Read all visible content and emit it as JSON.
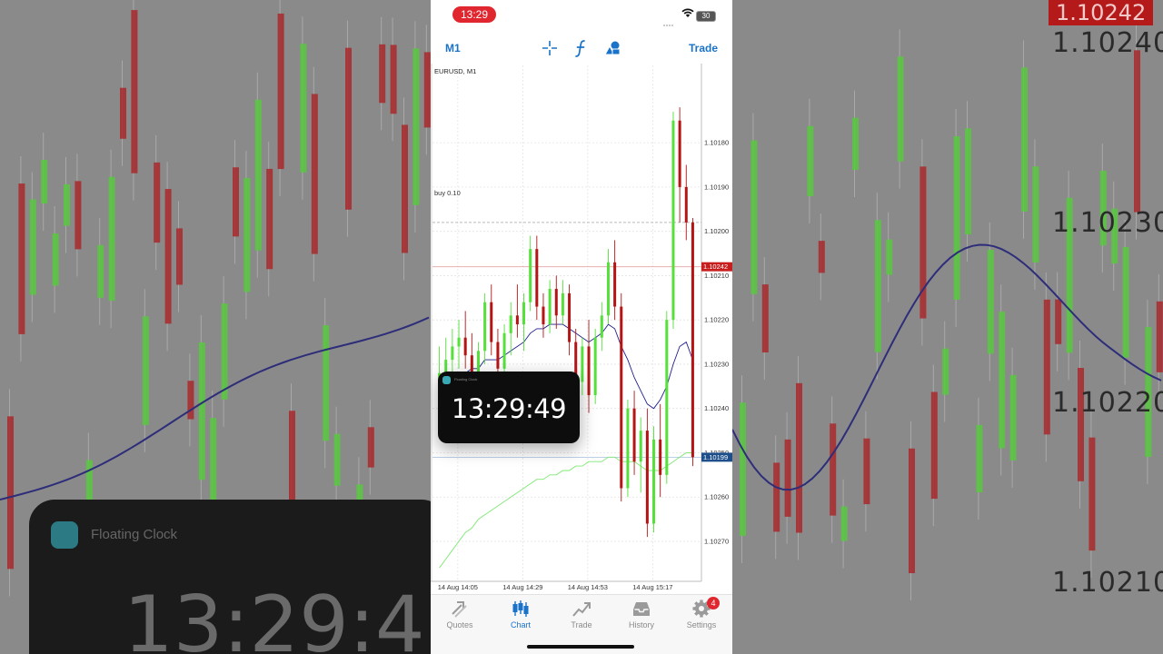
{
  "status_bar": {
    "time": "13:29",
    "battery": "30"
  },
  "toolbar": {
    "timeframe": "M1",
    "trade": "Trade"
  },
  "chart": {
    "symbol_label": "EURUSD, M1",
    "order_line_label": "buy 0.10",
    "ask_price": "1.10242",
    "bid_price": "1.10199",
    "price_ticks": [
      "1.10270",
      "1.10260",
      "1.10250",
      "1.10240",
      "1.10230",
      "1.10220",
      "1.10210",
      "1.10200",
      "1.10190",
      "1.10180"
    ],
    "time_ticks": [
      "14 Aug 14:05",
      "14 Aug 14:29",
      "14 Aug 14:53",
      "14 Aug 15:17"
    ]
  },
  "chart_data": {
    "type": "candlestick",
    "symbol": "EURUSD",
    "timeframe": "M1",
    "ylim": [
      1.10172,
      1.10285
    ],
    "y_ticks": [
      1.1018,
      1.1019,
      1.102,
      1.1021,
      1.1022,
      1.1023,
      1.1024,
      1.1025,
      1.1026,
      1.1027
    ],
    "x_ticks": [
      "14 Aug 14:05",
      "14 Aug 14:29",
      "14 Aug 14:53",
      "14 Aug 15:17"
    ],
    "ask": 1.10242,
    "bid": 1.10199,
    "order_level": 1.10252,
    "candles": [
      [
        1.10214,
        1.10224,
        1.10209,
        1.10218
      ],
      [
        1.10218,
        1.10226,
        1.10213,
        1.10221
      ],
      [
        1.10221,
        1.10228,
        1.10216,
        1.10224
      ],
      [
        1.10224,
        1.1023,
        1.10219,
        1.10226
      ],
      [
        1.10226,
        1.10232,
        1.10219,
        1.10222
      ],
      [
        1.10222,
        1.10227,
        1.10214,
        1.10217
      ],
      [
        1.10217,
        1.10225,
        1.10213,
        1.10223
      ],
      [
        1.10223,
        1.10236,
        1.1022,
        1.10234
      ],
      [
        1.10234,
        1.10238,
        1.10222,
        1.10225
      ],
      [
        1.10225,
        1.10228,
        1.10216,
        1.10219
      ],
      [
        1.10219,
        1.10229,
        1.10216,
        1.10227
      ],
      [
        1.10227,
        1.10234,
        1.10222,
        1.10231
      ],
      [
        1.10231,
        1.10238,
        1.10226,
        1.10229
      ],
      [
        1.10229,
        1.10236,
        1.10223,
        1.10234
      ],
      [
        1.10234,
        1.10249,
        1.10232,
        1.10246
      ],
      [
        1.10246,
        1.10249,
        1.1023,
        1.10233
      ],
      [
        1.10233,
        1.10236,
        1.10226,
        1.10229
      ],
      [
        1.10229,
        1.10239,
        1.10227,
        1.10237
      ],
      [
        1.10237,
        1.1024,
        1.10228,
        1.10231
      ],
      [
        1.10231,
        1.10239,
        1.10229,
        1.10236
      ],
      [
        1.10236,
        1.10238,
        1.10222,
        1.10225
      ],
      [
        1.10225,
        1.10228,
        1.10212,
        1.10216
      ],
      [
        1.10216,
        1.10226,
        1.10213,
        1.10224
      ],
      [
        1.10224,
        1.1023,
        1.10209,
        1.10213
      ],
      [
        1.10213,
        1.10228,
        1.10211,
        1.10226
      ],
      [
        1.10226,
        1.10234,
        1.10223,
        1.10231
      ],
      [
        1.10231,
        1.10246,
        1.10229,
        1.10243
      ],
      [
        1.10243,
        1.10248,
        1.1023,
        1.10233
      ],
      [
        1.10233,
        1.10236,
        1.10189,
        1.10192
      ],
      [
        1.10192,
        1.10212,
        1.1019,
        1.1021
      ],
      [
        1.1021,
        1.10214,
        1.10195,
        1.10198
      ],
      [
        1.10198,
        1.10208,
        1.10191,
        1.10205
      ],
      [
        1.10205,
        1.1021,
        1.10181,
        1.10184
      ],
      [
        1.10184,
        1.10206,
        1.10182,
        1.10203
      ],
      [
        1.10203,
        1.10211,
        1.1019,
        1.10195
      ],
      [
        1.10195,
        1.10232,
        1.10193,
        1.1023
      ],
      [
        1.1023,
        1.10277,
        1.10228,
        1.10275
      ],
      [
        1.10275,
        1.10278,
        1.10252,
        1.1026
      ],
      [
        1.1026,
        1.10265,
        1.10248,
        1.10252
      ],
      [
        1.10252,
        1.10253,
        1.10197,
        1.10199
      ]
    ],
    "series": [
      {
        "values": [
          1.10215,
          1.10215,
          1.10216,
          1.10217,
          1.10218,
          1.10219,
          1.10219,
          1.10221,
          1.10221,
          1.10221,
          1.10222,
          1.10223,
          1.10224,
          1.10225,
          1.10227,
          1.10228,
          1.10228,
          1.10229,
          1.10229,
          1.10229,
          1.10228,
          1.10227,
          1.10226,
          1.10225,
          1.10226,
          1.10227,
          1.10229,
          1.10228,
          1.10224,
          1.10221,
          1.10217,
          1.10214,
          1.10211,
          1.1021,
          1.10212,
          1.10215,
          1.1022,
          1.10224,
          1.10225,
          1.10221
        ]
      },
      {
        "values": [
          1.10174,
          1.10176,
          1.10178,
          1.1018,
          1.10182,
          1.10183,
          1.10185,
          1.10186,
          1.10187,
          1.10188,
          1.10189,
          1.1019,
          1.10191,
          1.10192,
          1.10193,
          1.10194,
          1.10194,
          1.10195,
          1.10195,
          1.10196,
          1.10196,
          1.10197,
          1.10197,
          1.10198,
          1.10198,
          1.10198,
          1.10199,
          1.10199,
          1.10198,
          1.10198,
          1.10198,
          1.10197,
          1.10196,
          1.10196,
          1.10196,
          1.10197,
          1.10198,
          1.10199,
          1.102,
          1.102
        ]
      }
    ]
  },
  "floating_clock": {
    "title": "Floating Clock",
    "time": "13:29:49"
  },
  "background": {
    "prices": [
      "1.10240",
      "1.10230",
      "1.10220",
      "1.10210"
    ],
    "price_tag": "1.10242",
    "clock_title": "Floating Clock",
    "clock_time": "13:29:4"
  },
  "tabs": [
    {
      "label": "Quotes",
      "icon": "quotes-icon"
    },
    {
      "label": "Chart",
      "icon": "candlestick-icon"
    },
    {
      "label": "Trade",
      "icon": "trade-icon"
    },
    {
      "label": "History",
      "icon": "inbox-icon"
    },
    {
      "label": "Settings",
      "icon": "gear-icon"
    }
  ],
  "settings_badge": "4",
  "colors": {
    "bull": "#55e03a",
    "bear": "#b51414",
    "accent": "#1a73c9",
    "ask_tag": "#c81e1e",
    "bid_tag": "#1e4f8a",
    "ma_fast": "#1f1f8f",
    "ma_slow": "#7fe874"
  }
}
